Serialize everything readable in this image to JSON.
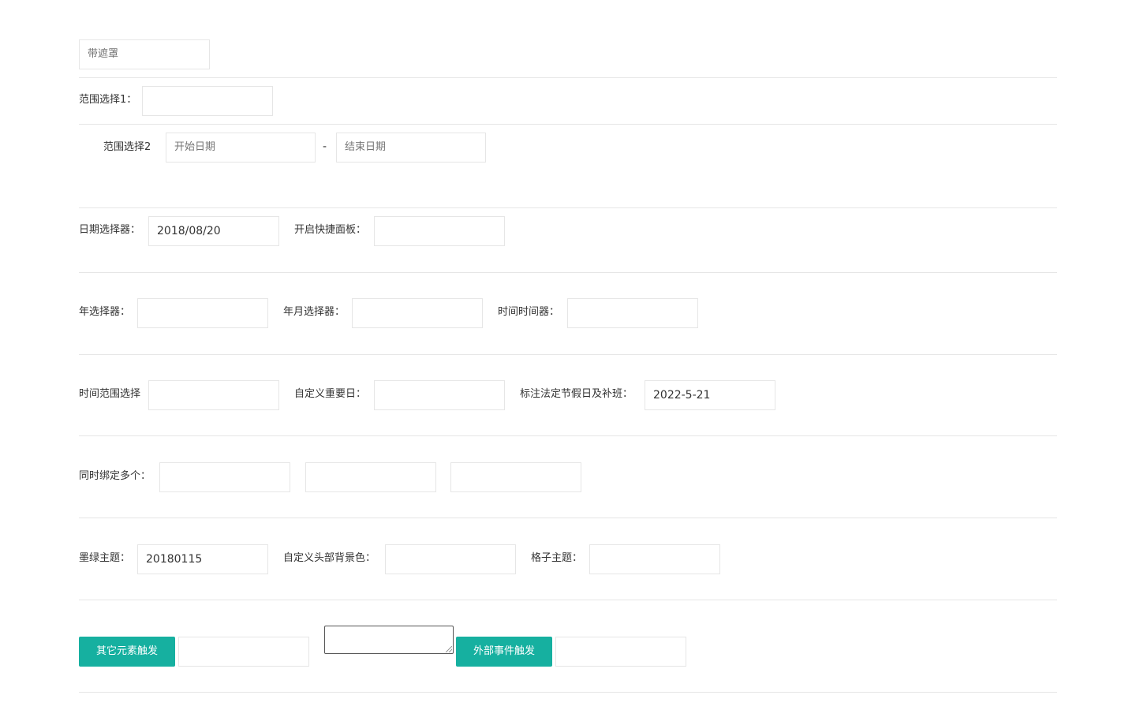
{
  "row_mask": {
    "placeholder": "带遮罩"
  },
  "row_range1": {
    "label": "范围选择1："
  },
  "row_range2": {
    "label": "范围选择2",
    "start_placeholder": "开始日期",
    "separator": "-",
    "end_placeholder": "结束日期"
  },
  "row_date": {
    "date_label": "日期选择器：",
    "date_value": "2018/08/20",
    "quick_label": "开启快捷面板："
  },
  "row_year": {
    "year_label": "年选择器：",
    "month_label": "年月选择器：",
    "time_label": "时间时间器："
  },
  "row_time_range": {
    "time_range_label": "时间范围选择",
    "important_label": "自定义重要日：",
    "holiday_label": "标注法定节假日及补班：",
    "holiday_value": "2022-5-21"
  },
  "row_multi": {
    "label": "同时绑定多个："
  },
  "row_theme": {
    "green_label": "墨绿主题：",
    "green_value": "20180115",
    "header_bg_label": "自定义头部背景色：",
    "grid_label": "格子主题："
  },
  "row_trigger": {
    "other_button": "其它元素触发",
    "external_button": "外部事件触发"
  },
  "colors": {
    "button_bg": "#16b0a0",
    "border": "#e6e6e6",
    "divider": "#e6e6e6"
  }
}
